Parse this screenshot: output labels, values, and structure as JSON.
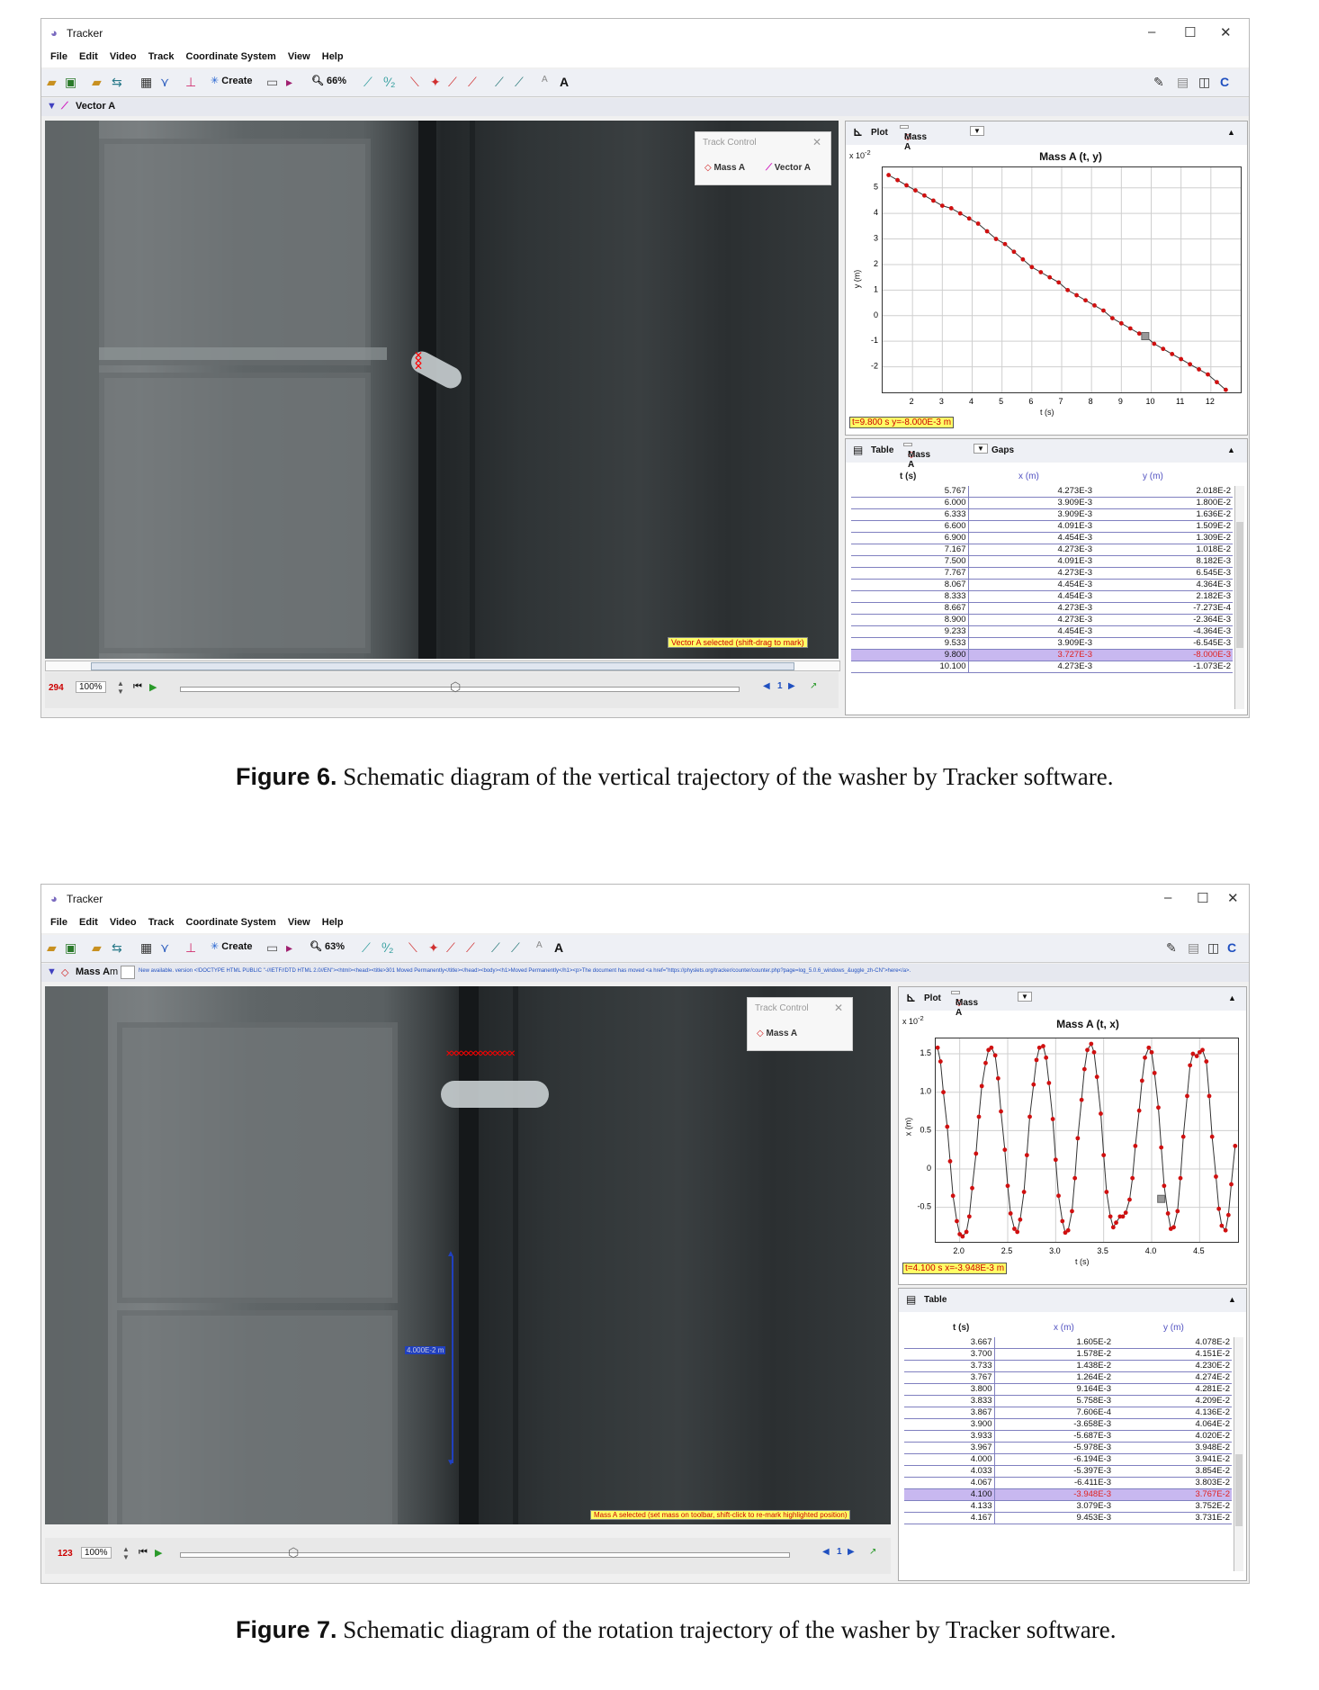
{
  "window1": {
    "app_title": "Tracker",
    "menu": [
      "File",
      "Edit",
      "Video",
      "Track",
      "Coordinate System",
      "View",
      "Help"
    ],
    "toolbar": {
      "create_label": "Create",
      "zoom": "66%"
    },
    "track_label": "Vector A",
    "track_control": {
      "title": "Track Control",
      "items": [
        "Mass A",
        "Vector A"
      ]
    },
    "status_text": "Vector A selected (shift-drag to mark)",
    "frame_number": "294",
    "playback_zoom": "100%",
    "step_size": "1",
    "plot": {
      "label": "Plot",
      "track": "Mass A",
      "title": "Mass A (t, y)",
      "scale_label": "x 10",
      "scale_exp": "-2",
      "ylabel": "y (m)",
      "xlabel": "t (s)",
      "readout": "t=9.800 s  y=-8.000E-3 m"
    },
    "table": {
      "label": "Table",
      "track": "Mass A",
      "gaps_label": "Gaps",
      "columns": [
        "t (s)",
        "x (m)",
        "y (m)"
      ],
      "rows": [
        [
          "5.767",
          "4.273E-3",
          "2.018E-2"
        ],
        [
          "6.000",
          "3.909E-3",
          "1.800E-2"
        ],
        [
          "6.333",
          "3.909E-3",
          "1.636E-2"
        ],
        [
          "6.600",
          "4.091E-3",
          "1.509E-2"
        ],
        [
          "6.900",
          "4.454E-3",
          "1.309E-2"
        ],
        [
          "7.167",
          "4.273E-3",
          "1.018E-2"
        ],
        [
          "7.500",
          "4.091E-3",
          "8.182E-3"
        ],
        [
          "7.767",
          "4.273E-3",
          "6.545E-3"
        ],
        [
          "8.067",
          "4.454E-3",
          "4.364E-3"
        ],
        [
          "8.333",
          "4.454E-3",
          "2.182E-3"
        ],
        [
          "8.667",
          "4.273E-3",
          "-7.273E-4"
        ],
        [
          "8.900",
          "4.273E-3",
          "-2.364E-3"
        ],
        [
          "9.233",
          "4.454E-3",
          "-4.364E-3"
        ],
        [
          "9.533",
          "3.909E-3",
          "-6.545E-3"
        ],
        [
          "9.800",
          "3.727E-3",
          "-8.000E-3"
        ],
        [
          "10.100",
          "4.273E-3",
          "-1.073E-2"
        ]
      ],
      "selected_row": 14
    }
  },
  "window2": {
    "app_title": "Tracker",
    "menu": [
      "File",
      "Edit",
      "Video",
      "Track",
      "Coordinate System",
      "View",
      "Help"
    ],
    "toolbar": {
      "create_label": "Create",
      "zoom": "63%"
    },
    "track_label": "Mass A",
    "mass_field": "m",
    "news_text": "New available. version <!DOCTYPE HTML PUBLIC \"-//IETF//DTD HTML 2.0//EN\"><html><head><title>301 Moved Permanently</title></head><body><h1>Moved Permanently</h1><p>The document has moved <a href=\"https://physlets.org/tracker/counter/counter.php?page=log_5.0.6_windows_&uggle_zh-CN\">here</a>.",
    "track_control": {
      "title": "Track Control",
      "items": [
        "Mass A"
      ]
    },
    "vector_label": "4.000E-2 m",
    "status_text": "Mass A selected (set mass on toolbar, shift-click to re-mark highlighted position)",
    "frame_number": "123",
    "playback_zoom": "100%",
    "step_size": "1",
    "plot": {
      "label": "Plot",
      "track": "Mass A",
      "title": "Mass A (t, x)",
      "scale_label": "x 10",
      "scale_exp": "-2",
      "ylabel": "x (m)",
      "xlabel": "t (s)",
      "readout": "t=4.100 s  x=-3.948E-3 m"
    },
    "table": {
      "label": "Table",
      "columns": [
        "t (s)",
        "x (m)",
        "y (m)"
      ],
      "rows": [
        [
          "3.667",
          "1.605E-2",
          "4.078E-2"
        ],
        [
          "3.700",
          "1.578E-2",
          "4.151E-2"
        ],
        [
          "3.733",
          "1.438E-2",
          "4.230E-2"
        ],
        [
          "3.767",
          "1.264E-2",
          "4.274E-2"
        ],
        [
          "3.800",
          "9.164E-3",
          "4.281E-2"
        ],
        [
          "3.833",
          "5.758E-3",
          "4.209E-2"
        ],
        [
          "3.867",
          "7.606E-4",
          "4.136E-2"
        ],
        [
          "3.900",
          "-3.658E-3",
          "4.064E-2"
        ],
        [
          "3.933",
          "-5.687E-3",
          "4.020E-2"
        ],
        [
          "3.967",
          "-5.978E-3",
          "3.948E-2"
        ],
        [
          "4.000",
          "-6.194E-3",
          "3.941E-2"
        ],
        [
          "4.033",
          "-5.397E-3",
          "3.854E-2"
        ],
        [
          "4.067",
          "-6.411E-3",
          "3.803E-2"
        ],
        [
          "4.100",
          "-3.948E-3",
          "3.767E-2"
        ],
        [
          "4.133",
          "3.079E-3",
          "3.752E-2"
        ],
        [
          "4.167",
          "9.453E-3",
          "3.731E-2"
        ]
      ],
      "selected_row": 13
    }
  },
  "captions": [
    {
      "label": "Figure 6.",
      "text": " Schematic diagram of the vertical trajectory of the washer by Tracker software."
    },
    {
      "label": "Figure 7.",
      "text": " Schematic diagram of the rotation trajectory of the washer by Tracker software."
    }
  ],
  "chart_data": [
    {
      "type": "line",
      "title": "Mass A (t, y)",
      "xlabel": "t (s)",
      "ylabel": "y (m)",
      "y_scale_note": "x 10^-2",
      "xlim": [
        1,
        13
      ],
      "ylim": [
        -3,
        5.8
      ],
      "x_ticks": [
        2,
        3,
        4,
        5,
        6,
        7,
        8,
        9,
        10,
        11,
        12
      ],
      "y_ticks": [
        -2,
        -1,
        0,
        1,
        2,
        3,
        4,
        5
      ],
      "series": [
        {
          "x": [
            1.2,
            1.5,
            1.8,
            2.1,
            2.4,
            2.7,
            3.0,
            3.3,
            3.6,
            3.9,
            4.2,
            4.5,
            4.8,
            5.1,
            5.4,
            5.7,
            6.0,
            6.3,
            6.6,
            6.9,
            7.2,
            7.5,
            7.8,
            8.1,
            8.4,
            8.7,
            9.0,
            9.3,
            9.6,
            9.8,
            10.1,
            10.4,
            10.7,
            11.0,
            11.3,
            11.6,
            11.9,
            12.2,
            12.5
          ],
          "y": [
            5.5,
            5.3,
            5.1,
            4.9,
            4.7,
            4.5,
            4.3,
            4.2,
            4.0,
            3.8,
            3.6,
            3.3,
            3.0,
            2.8,
            2.5,
            2.2,
            1.9,
            1.7,
            1.5,
            1.3,
            1.0,
            0.8,
            0.6,
            0.4,
            0.2,
            -0.1,
            -0.3,
            -0.5,
            -0.7,
            -0.8,
            -1.1,
            -1.3,
            -1.5,
            -1.7,
            -1.9,
            -2.1,
            -2.3,
            -2.6,
            -2.9
          ]
        }
      ],
      "highlight": {
        "x": 9.8,
        "y": -0.8
      }
    },
    {
      "type": "line",
      "title": "Mass A (t, x)",
      "xlabel": "t (s)",
      "ylabel": "x (m)",
      "y_scale_note": "x 10^-2",
      "xlim": [
        1.75,
        4.9
      ],
      "ylim": [
        -0.95,
        1.7
      ],
      "x_ticks": [
        2.0,
        2.5,
        3.0,
        3.5,
        4.0,
        4.5
      ],
      "x_tick_labels": [
        "2.0",
        "2.5",
        "3.0",
        "3.5",
        "4.0",
        "4.5"
      ],
      "y_ticks": [
        -0.5,
        0,
        0.5,
        1.0,
        1.5
      ],
      "y_tick_labels": [
        "-0.5",
        "0",
        "0.5",
        "1.0",
        "1.5"
      ],
      "series": [
        {
          "x": [
            1.77,
            1.8,
            1.83,
            1.87,
            1.9,
            1.93,
            1.97,
            2.0,
            2.03,
            2.07,
            2.1,
            2.13,
            2.17,
            2.2,
            2.23,
            2.27,
            2.3,
            2.33,
            2.37,
            2.4,
            2.43,
            2.47,
            2.5,
            2.53,
            2.57,
            2.6,
            2.63,
            2.67,
            2.7,
            2.73,
            2.77,
            2.8,
            2.83,
            2.87,
            2.9,
            2.93,
            2.97,
            3.0,
            3.03,
            3.07,
            3.1,
            3.13,
            3.17,
            3.2,
            3.23,
            3.27,
            3.3,
            3.33,
            3.37,
            3.4,
            3.43,
            3.47,
            3.5,
            3.53,
            3.57,
            3.6,
            3.63,
            3.67,
            3.7,
            3.73,
            3.77,
            3.8,
            3.83,
            3.87,
            3.9,
            3.93,
            3.97,
            4.0,
            4.03,
            4.07,
            4.1,
            4.13,
            4.17,
            4.2,
            4.23,
            4.27,
            4.3,
            4.33,
            4.37,
            4.4,
            4.43,
            4.47,
            4.5,
            4.53,
            4.57,
            4.6,
            4.63,
            4.67,
            4.7,
            4.73,
            4.77,
            4.8,
            4.83,
            4.87
          ],
          "y": [
            1.58,
            1.4,
            1.0,
            0.55,
            0.1,
            -0.35,
            -0.68,
            -0.85,
            -0.88,
            -0.82,
            -0.62,
            -0.25,
            0.2,
            0.68,
            1.08,
            1.38,
            1.55,
            1.58,
            1.48,
            1.18,
            0.75,
            0.25,
            -0.22,
            -0.58,
            -0.78,
            -0.82,
            -0.66,
            -0.3,
            0.18,
            0.68,
            1.1,
            1.42,
            1.58,
            1.6,
            1.45,
            1.12,
            0.65,
            0.12,
            -0.35,
            -0.68,
            -0.83,
            -0.8,
            -0.55,
            -0.12,
            0.4,
            0.9,
            1.3,
            1.55,
            1.63,
            1.52,
            1.2,
            0.72,
            0.18,
            -0.3,
            -0.62,
            -0.76,
            -0.7,
            -0.62,
            -0.62,
            -0.57,
            -0.4,
            -0.12,
            0.3,
            0.76,
            1.15,
            1.45,
            1.58,
            1.52,
            1.25,
            0.8,
            0.28,
            -0.22,
            -0.58,
            -0.78,
            -0.76,
            -0.55,
            -0.12,
            0.42,
            0.95,
            1.35,
            1.5,
            1.47,
            1.52,
            1.55,
            1.4,
            0.95,
            0.42,
            -0.1,
            -0.52,
            -0.74,
            -0.8,
            -0.6,
            -0.2,
            0.3
          ]
        }
      ],
      "highlight": {
        "x": 4.1,
        "y": -0.39
      }
    }
  ]
}
